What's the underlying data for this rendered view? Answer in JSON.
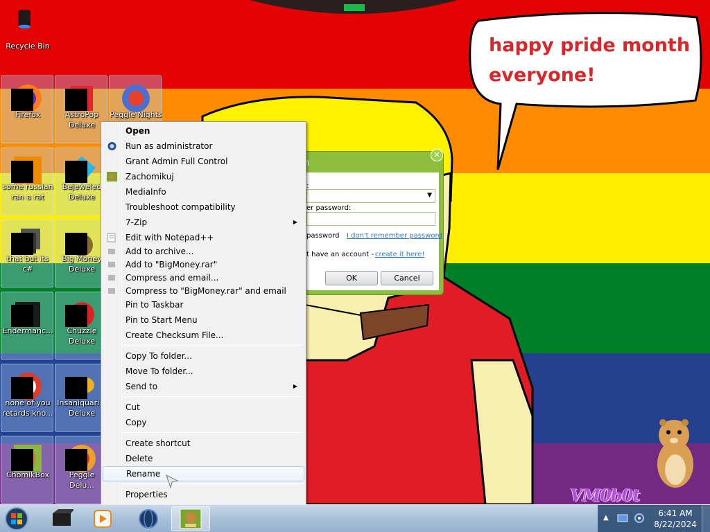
{
  "desktop": {
    "wallpaper_colors": [
      "#e40303",
      "#ff8c00",
      "#ffed00",
      "#008026",
      "#24408e",
      "#732982"
    ],
    "speech_bubble": {
      "line1": "happy pride month",
      "line2": "everyone!"
    },
    "watermark": "VM0b0t",
    "icons": [
      {
        "label": "Recycle Bin",
        "icon": "recycle-bin-icon"
      },
      {
        "label": "Firefox",
        "icon": "firefox-icon"
      },
      {
        "label": "AstroPop\nDeluxe",
        "icon": "astropop-icon"
      },
      {
        "label": "Peggle Nights",
        "icon": "peggle-nights-icon"
      },
      {
        "label": "some russian\nran a rat",
        "icon": "app-icon"
      },
      {
        "label": "Bejeweled\nDeluxe",
        "icon": "bejeweled-icon"
      },
      {
        "label": "that but its c#",
        "icon": "app-icon"
      },
      {
        "label": "Big Money\nDeluxe",
        "icon": "big-money-icon"
      },
      {
        "label": "Endermanc...",
        "icon": "app-icon"
      },
      {
        "label": "Chuzzle\nDeluxe",
        "icon": "chuzzle-icon"
      },
      {
        "label": "none of you\nretards kno...",
        "icon": "app-icon"
      },
      {
        "label": "Insaniquari...\nDeluxe",
        "icon": "insaniquarium-icon"
      },
      {
        "label": "ChomikBox",
        "icon": "chomikbox-icon"
      },
      {
        "label": "Peggle Delu...",
        "icon": "peggle-icon"
      }
    ]
  },
  "dialog": {
    "title": "n",
    "login_label": ":",
    "password_label": "er password:",
    "remember_text": "password",
    "forgot_link": "I don't remember password",
    "no_account_text": "t have an account -",
    "create_link": "create it here!",
    "ok_label": "OK",
    "cancel_label": "Cancel",
    "close_glyph": "×"
  },
  "context_menu": {
    "items": [
      {
        "label": "Open",
        "bold": true
      },
      {
        "label": "Run as administrator",
        "icon": "shield-icon"
      },
      {
        "label": "Grant Admin Full Control"
      },
      {
        "label": "Zachomikuj",
        "icon": "chomikbox-icon"
      },
      {
        "label": "MediaInfo"
      },
      {
        "label": "Troubleshoot compatibility"
      },
      {
        "label": "7-Zip",
        "submenu": true
      },
      {
        "label": "Edit with Notepad++",
        "icon": "notepad-icon"
      },
      {
        "label": "Add to archive...",
        "icon": "archive-icon"
      },
      {
        "label": "Add to \"BigMoney.rar\"",
        "icon": "archive-icon"
      },
      {
        "label": "Compress and email...",
        "icon": "archive-icon"
      },
      {
        "label": "Compress to \"BigMoney.rar\" and email",
        "icon": "archive-icon"
      },
      {
        "label": "Pin to Taskbar"
      },
      {
        "label": "Pin to Start Menu"
      },
      {
        "label": "Create Checksum File..."
      },
      {
        "label": "Copy To folder..."
      },
      {
        "label": "Move To folder..."
      },
      {
        "label": "Send to",
        "submenu": true
      },
      {
        "label": "Cut"
      },
      {
        "label": "Copy"
      },
      {
        "label": "Create shortcut"
      },
      {
        "label": "Delete"
      },
      {
        "label": "Rename",
        "highlighted": true
      },
      {
        "label": "Properties"
      }
    ],
    "submenu_glyph": "▶"
  },
  "taskbar": {
    "pinned": [
      "start-orb-icon",
      "box-app-icon",
      "media-player-icon",
      "browser-globe-icon",
      "chomikbox-icon"
    ],
    "tray": {
      "time": "6:41 AM",
      "date": "8/22/2024"
    }
  }
}
